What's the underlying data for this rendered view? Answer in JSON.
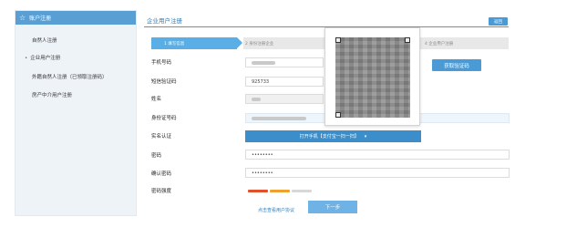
{
  "sidebar": {
    "header": "账户注册",
    "items": [
      {
        "label": "自然人注册",
        "active": false
      },
      {
        "label": "企业用户注册",
        "active": true
      },
      {
        "label": "外籍自然人注册（已领取注册码）",
        "active": false
      },
      {
        "label": "房产中介用户注册",
        "active": false
      }
    ]
  },
  "page": {
    "title": "企业用户注册",
    "top_button": "返回"
  },
  "steps": [
    {
      "label": "1 填写信息",
      "active": true
    },
    {
      "label": "2 身份注册企业",
      "active": false
    },
    {
      "label": "4 企业用户注册",
      "active": false
    }
  ],
  "form": {
    "phone": {
      "label": "手机号码",
      "value": ""
    },
    "sms_code": {
      "label": "短信验证码",
      "value": "925733"
    },
    "get_code_button": "获取验证码",
    "name": {
      "label": "姓名",
      "value": ""
    },
    "id_number": {
      "label": "身份证号码",
      "value": ""
    },
    "real_name": {
      "label": "实名认证",
      "button": "打开手机【支付宝一扫一扫】"
    },
    "password": {
      "label": "密码",
      "value": "••••••••"
    },
    "confirm_password": {
      "label": "确认密码",
      "value": "••••••••"
    },
    "strength": {
      "label": "密码强度",
      "level": 2,
      "max": 3
    },
    "agreement_link": "点击查看用户协议",
    "next_button": "下一步"
  },
  "colors": {
    "primary": "#4a9ad6",
    "sidebar_header": "#5a9fd4",
    "strength_red": "#e0502a",
    "strength_orange": "#f0a030",
    "strength_grey": "#d8d8d8"
  }
}
